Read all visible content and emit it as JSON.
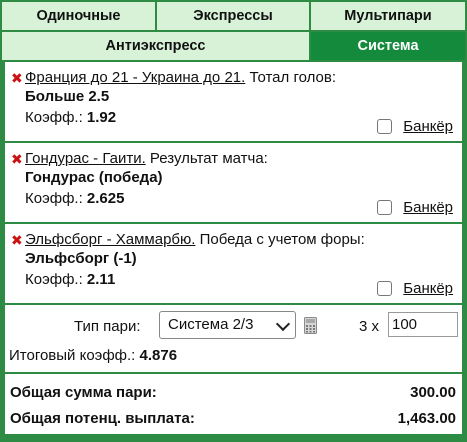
{
  "tabs": {
    "row1": [
      {
        "label": "Одиночные",
        "active": false
      },
      {
        "label": "Экспрессы",
        "active": false
      },
      {
        "label": "Мультипари",
        "active": false
      }
    ],
    "row2": [
      {
        "label": "Антиэкспресс",
        "active": false
      },
      {
        "label": "Система",
        "active": true
      }
    ]
  },
  "bets": [
    {
      "event": "Франция до 21 - Украина до 21.",
      "market": " Тотал голов:",
      "outcome": "Больше 2.5",
      "coef_label": "Коэфф.: ",
      "coef": "1.92",
      "banker_label": "Банкёр",
      "banker_checked": false
    },
    {
      "event": "Гондурас - Гаити.",
      "market": " Результат матча:",
      "outcome": "Гондурас (победа)",
      "coef_label": "Коэфф.: ",
      "coef": "2.625",
      "banker_label": "Банкёр",
      "banker_checked": false
    },
    {
      "event": "Эльфсборг - Хаммарбю.",
      "market": " Победа с учетом форы:",
      "outcome": "Эльфсборг (-1)",
      "coef_label": "Коэфф.: ",
      "coef": "2.11",
      "banker_label": "Банкёр",
      "banker_checked": false
    }
  ],
  "system": {
    "type_label": "Тип пари:",
    "type_value": "Система 2/3",
    "multiplier": "3 x",
    "amount": "100",
    "total_coef_label": "Итоговый коэфф.: ",
    "total_coef": "4.876"
  },
  "summary": {
    "total_stake_label": "Общая сумма пари:",
    "total_stake": "300.00",
    "potential_payout_label": "Общая потенц. выплата:",
    "potential_payout": "1,463.00"
  },
  "colors": {
    "accent": "#148a3c",
    "tab_bg": "#d8f2d8",
    "remove": "#cc1111"
  },
  "icons": {
    "remove": "close-x-icon",
    "calculator": "calculator-icon",
    "dropdown": "chevron-down-icon"
  }
}
